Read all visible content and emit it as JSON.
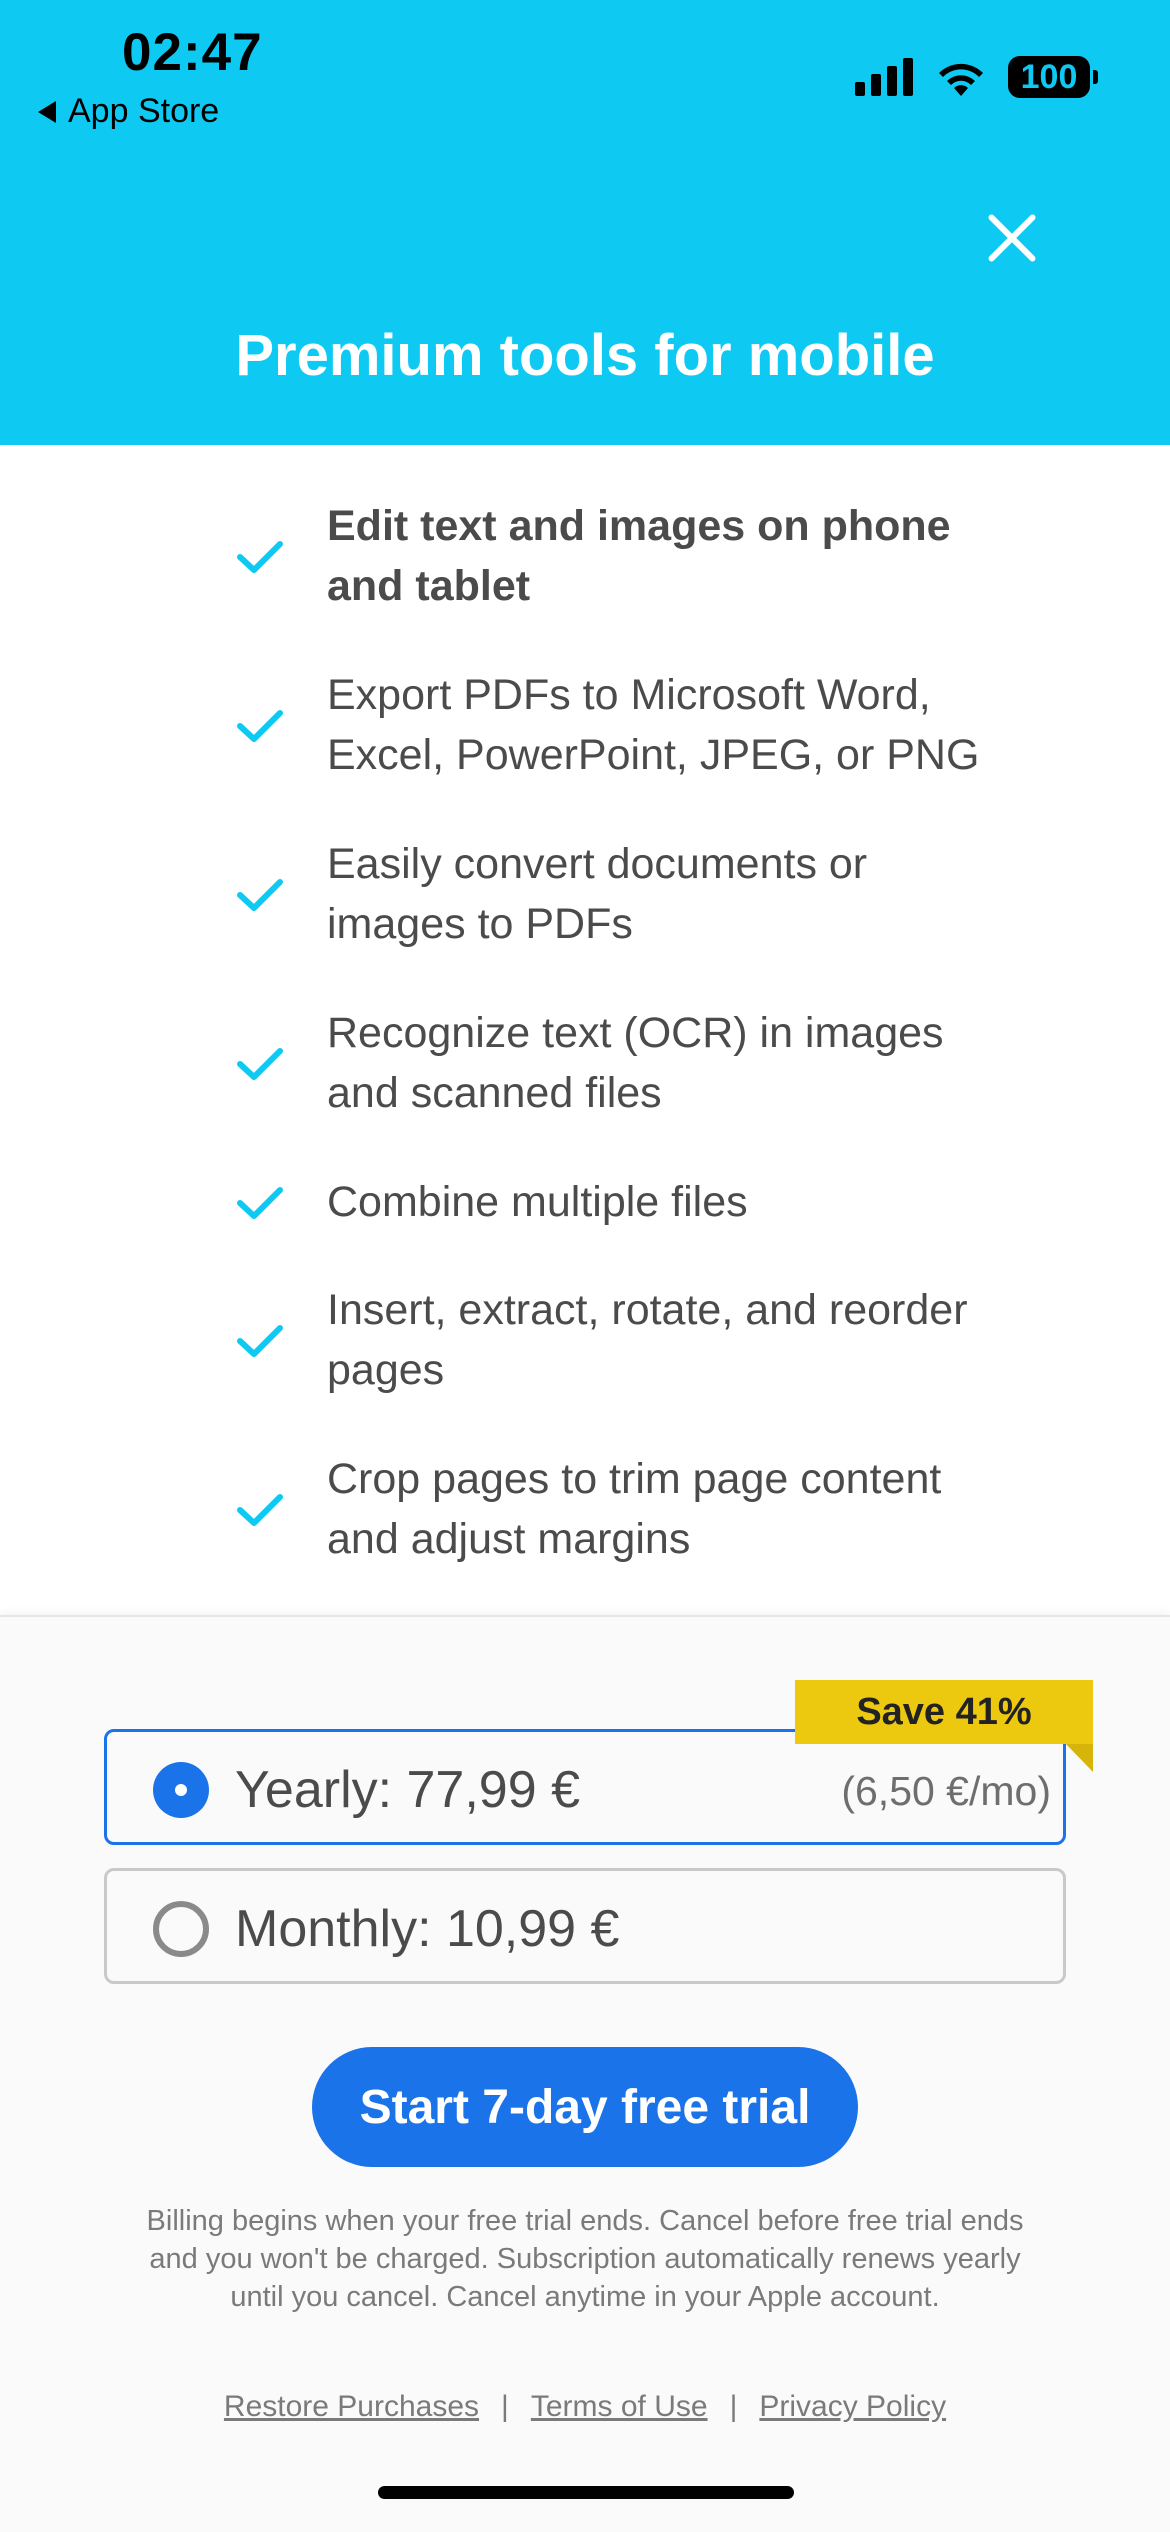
{
  "status_bar": {
    "time": "02:47",
    "back_app": "App Store",
    "battery": "100"
  },
  "header": {
    "title": "Premium tools for mobile",
    "background": "#0ecaf2"
  },
  "features": [
    "Edit text and images on phone and tablet",
    "Export PDFs to Microsoft Word, Excel, PowerPoint, JPEG, or PNG",
    "Easily convert documents or images to PDFs",
    "Recognize text (OCR) in images and scanned files",
    "Combine multiple files",
    "Insert, extract, rotate, and reorder pages",
    "Crop pages to trim page content and adjust margins"
  ],
  "plans": {
    "badge": "Save 41%",
    "yearly": {
      "label": "Yearly: 77,99 €",
      "sub": "(6,50 €/mo)",
      "selected": true
    },
    "monthly": {
      "label": "Monthly: 10,99 €",
      "selected": false
    }
  },
  "cta": {
    "label": "Start 7-day free trial",
    "color": "#1a73e8"
  },
  "disclaimer": "Billing begins when your free trial ends. Cancel before free trial ends and you won't be charged. Subscription automatically renews yearly until you cancel. Cancel anytime in your Apple account.",
  "links": {
    "restore": "Restore Purchases",
    "terms": "Terms of Use",
    "privacy": "Privacy Policy",
    "separator": "|"
  },
  "icons": {
    "close": "close-icon",
    "check": "checkmark-icon",
    "signal": "cellular-signal-icon",
    "wifi": "wifi-icon",
    "battery": "battery-icon"
  }
}
